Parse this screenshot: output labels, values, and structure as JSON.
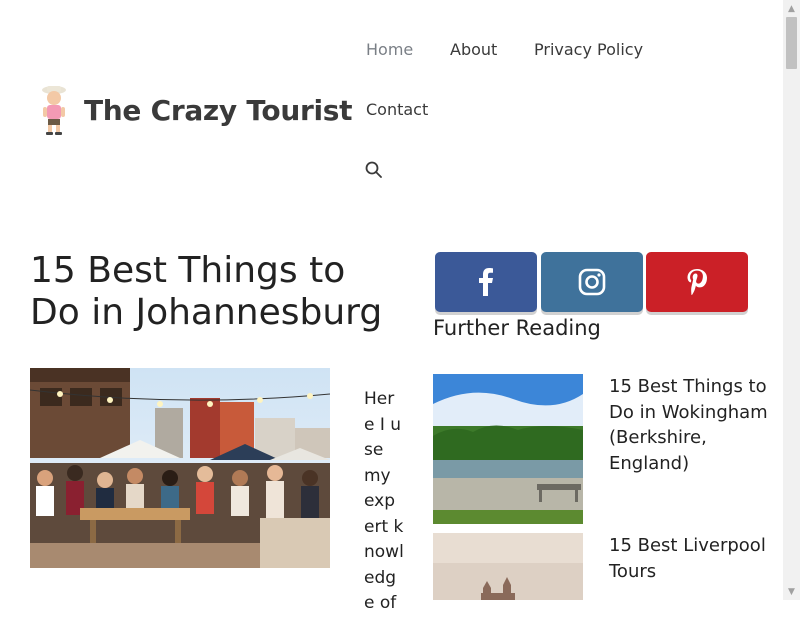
{
  "site": {
    "name": "The Crazy Tourist"
  },
  "nav": {
    "items": [
      "Home",
      "About",
      "Privacy Policy",
      "Contact"
    ],
    "active": "Home",
    "search_icon": "search-icon"
  },
  "article": {
    "title": "15 Best Things to Do in Johannesburg",
    "excerpt": "Here I use my expert knowledge of",
    "image_alt": "outdoor crowd at a rooftop bar"
  },
  "social": [
    {
      "name": "facebook",
      "icon": "facebook-icon",
      "color": "#3b5998"
    },
    {
      "name": "instagram",
      "icon": "instagram-icon",
      "color": "#3f729b"
    },
    {
      "name": "pinterest",
      "icon": "pinterest-icon",
      "color": "#cb2027"
    }
  ],
  "sidebar": {
    "heading": "Further Reading",
    "items": [
      {
        "title": "15 Best Things to Do in Wokingham (Berkshire, England)"
      },
      {
        "title": "15 Best Liverpool Tours"
      }
    ]
  },
  "colors": {
    "nav_active": "#7a7f86",
    "text": "#222222"
  }
}
